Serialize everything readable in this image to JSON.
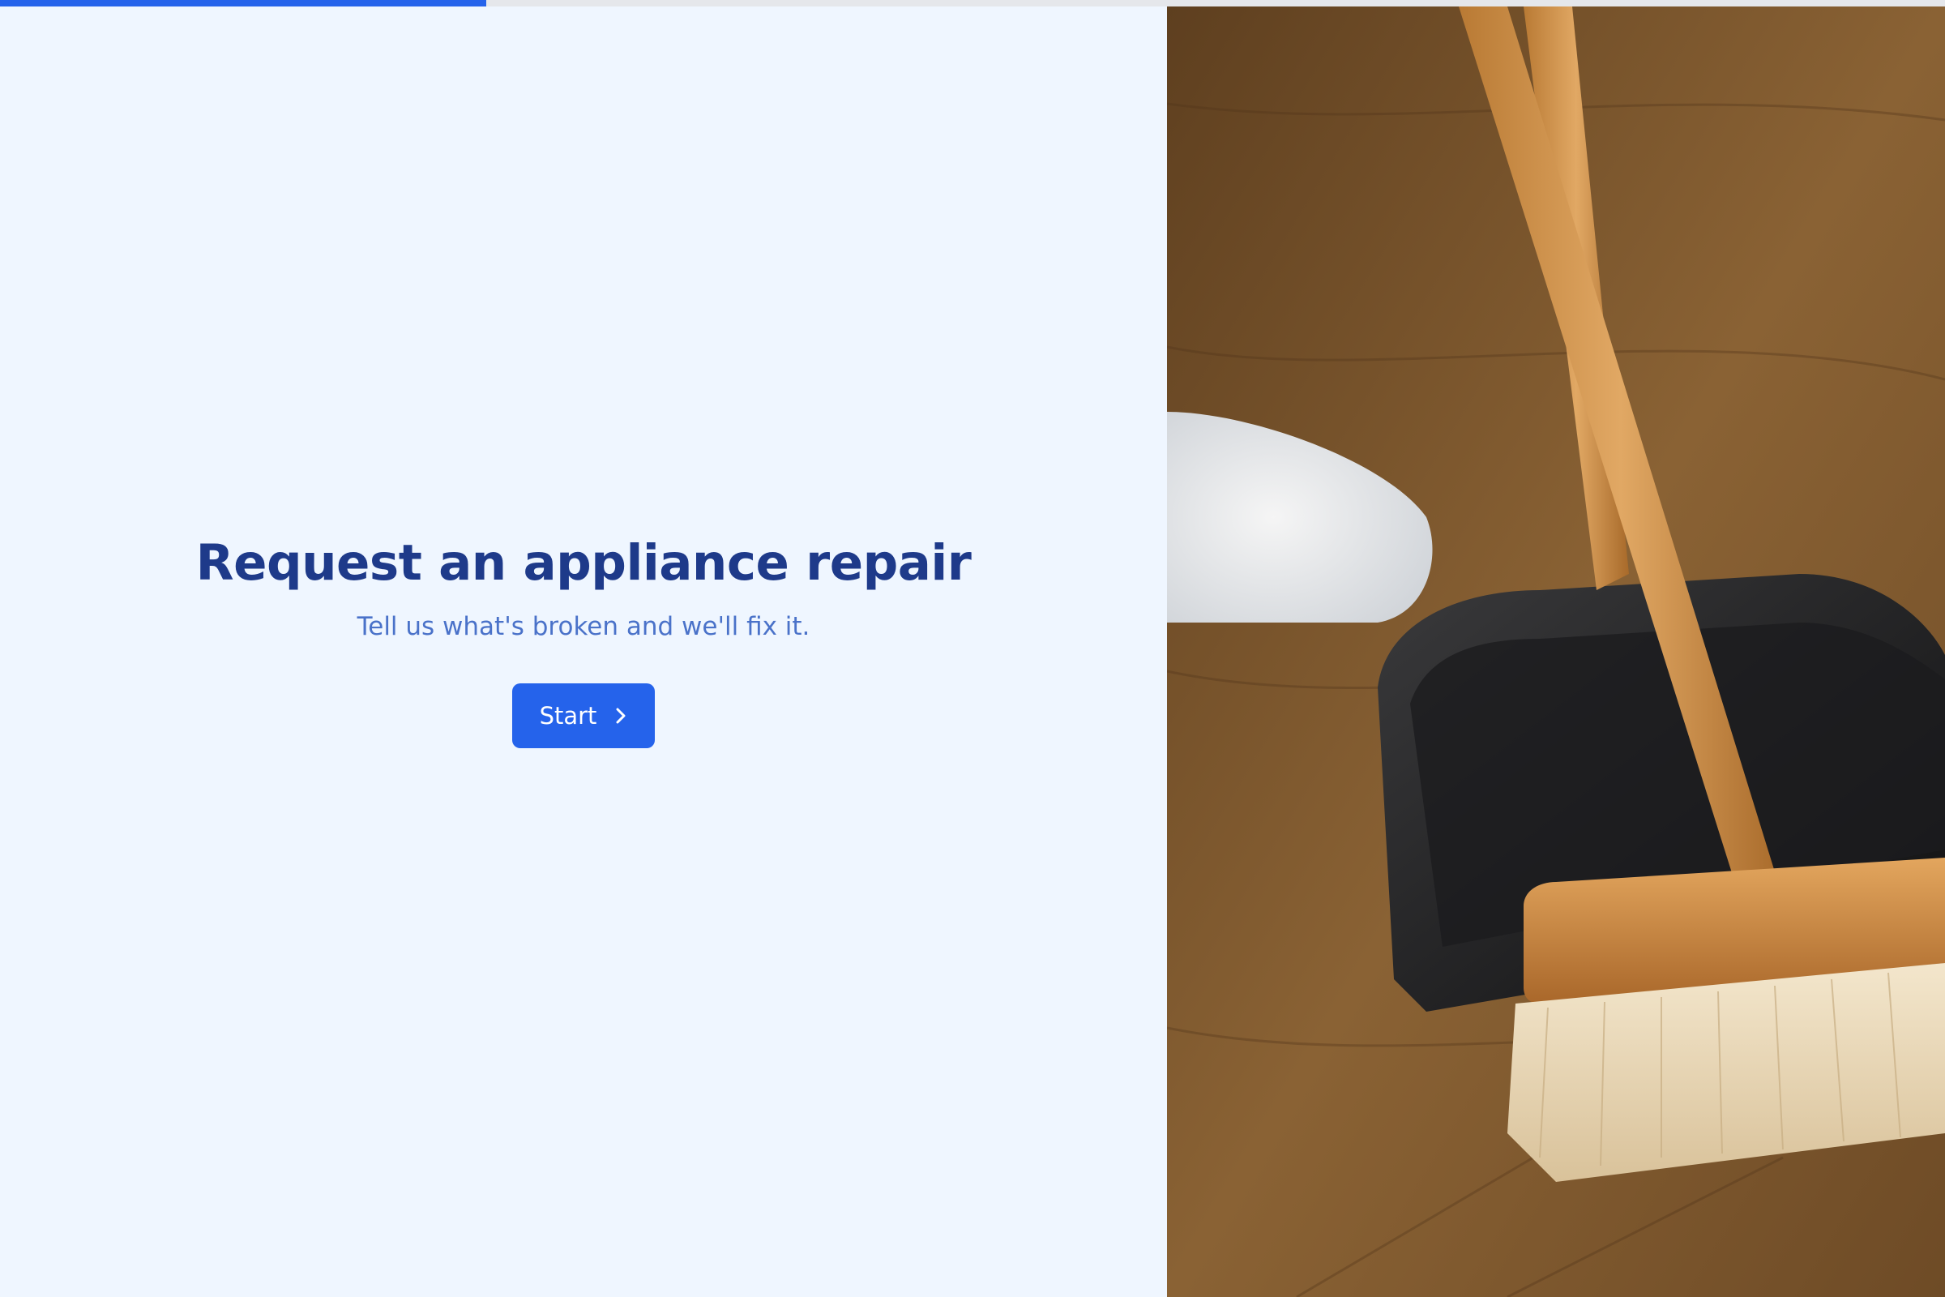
{
  "progress": {
    "value": 0.25
  },
  "hero": {
    "title": "Request an appliance repair",
    "subtitle": "Tell us what's broken and we'll fix it.",
    "start_label": "Start",
    "start_icon": "chevron-right-icon"
  },
  "photo": {
    "description_icon": "broom-dustpan-photo"
  },
  "colors": {
    "accent": "#2563eb",
    "title": "#1e3a8a",
    "subtitle": "#4a72c9",
    "background": "#eff6ff",
    "progress_track": "#e5e7eb"
  }
}
